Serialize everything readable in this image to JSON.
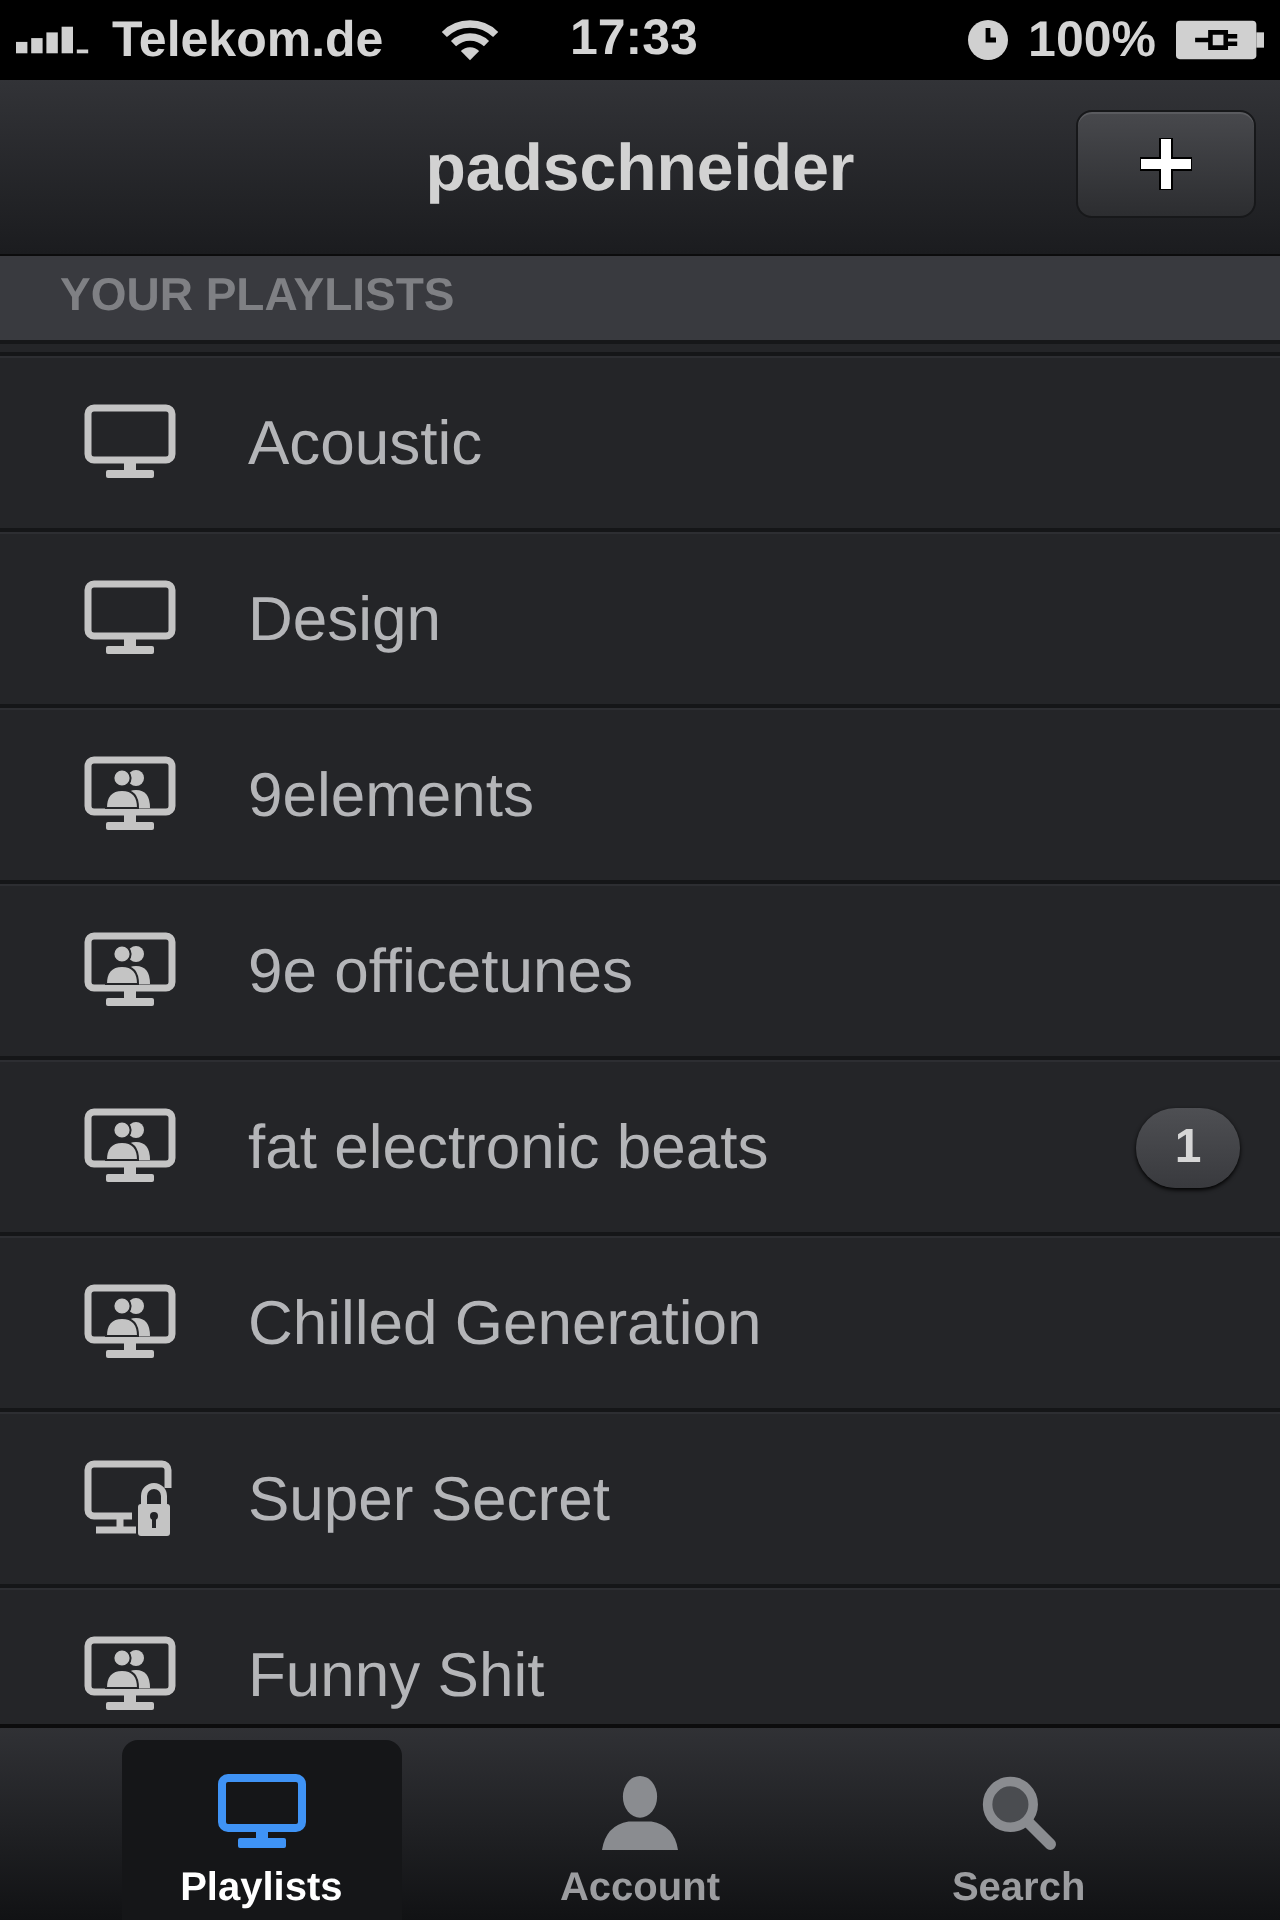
{
  "status_bar": {
    "carrier": "Telekom.de",
    "time": "17:33",
    "battery": "100%"
  },
  "nav_bar": {
    "title": "padschneider"
  },
  "section_header": "YOUR PLAYLISTS",
  "playlists": [
    {
      "name": "Acoustic",
      "kind": "plain"
    },
    {
      "name": "Design",
      "kind": "plain"
    },
    {
      "name": "9elements",
      "kind": "shared"
    },
    {
      "name": "9e officetunes",
      "kind": "shared"
    },
    {
      "name": "fat electronic beats",
      "kind": "shared",
      "badge": "1"
    },
    {
      "name": "Chilled Generation",
      "kind": "shared"
    },
    {
      "name": "Super Secret",
      "kind": "locked"
    },
    {
      "name": "Funny Shit",
      "kind": "shared"
    }
  ],
  "tab_bar": [
    {
      "label": "Playlists",
      "kind": "playlists",
      "selected": true
    },
    {
      "label": "Account",
      "kind": "account",
      "selected": false
    },
    {
      "label": "Search",
      "kind": "search",
      "selected": false
    }
  ]
}
